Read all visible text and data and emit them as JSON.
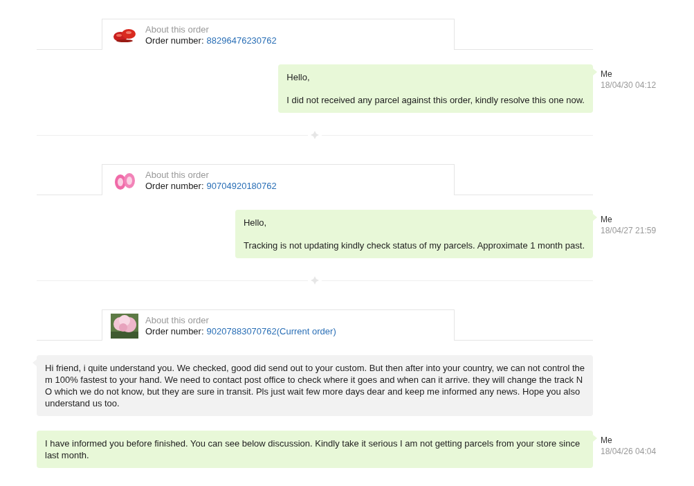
{
  "conversation": [
    {
      "kind": "order",
      "label": "About this order",
      "number_label": "Order number:",
      "number": "88296476230762",
      "picture": {
        "kind": "red"
      }
    },
    {
      "kind": "sent_message",
      "paragraphs": [
        "Hello,",
        "I did not received any parcel against this order, kindly resolve this one now."
      ],
      "author": "Me",
      "time": "18/04/30 04:12"
    },
    {
      "kind": "divider"
    },
    {
      "kind": "order",
      "label": "About this order",
      "number_label": "Order number:",
      "number": "90704920180762",
      "picture": {
        "kind": "pink"
      }
    },
    {
      "kind": "sent_message",
      "paragraphs": [
        "Hello,",
        "Tracking is not updating kindly check status of my parcels. Approximate 1 month past."
      ],
      "author": "Me",
      "time": "18/04/27 21:59"
    },
    {
      "kind": "divider"
    },
    {
      "kind": "order",
      "label": "About this order",
      "number_label": "Order number:",
      "number": "90207883070762(Current order)",
      "picture": {
        "kind": "flower"
      }
    },
    {
      "kind": "received_message",
      "paragraphs": [
        "Hi friend, i quite understand you. We checked, good did send out to your custom. But then after into your country, we can not control them 100% fastest to your hand. We need to contact post office to check where it goes and when can it arrive. they will change the track NO which we do not know, but they are sure in transit. Pls just wait few more days dear and keep me informed any news. Hope you also understand us too."
      ]
    },
    {
      "kind": "sent_message",
      "paragraphs": [
        "I have informed you before finished.  You can see below discussion. Kindly take it serious I am not getting parcels from your store since last month."
      ],
      "author": "Me",
      "time": "18/04/26 04:04"
    }
  ]
}
